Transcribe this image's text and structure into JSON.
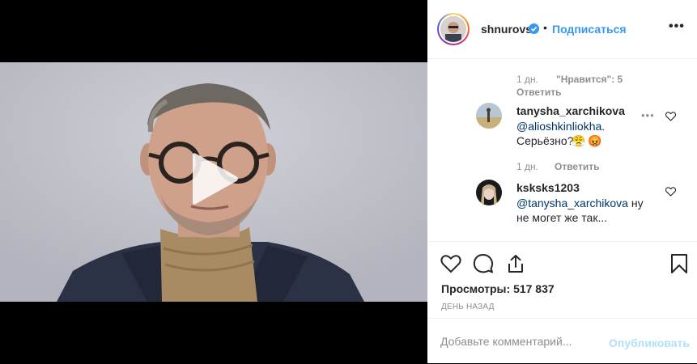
{
  "post": {
    "username": "shnurovs",
    "separator": "•",
    "follow_label": "Подписаться",
    "more_label": "•••"
  },
  "comments": {
    "reply_meta": {
      "time": "1 дн.",
      "likes": "\"Нравится\": 5",
      "reply_label": "Ответить"
    },
    "items": [
      {
        "username": "tanysha_xarchikova",
        "mention": "@alioshkinliokha.",
        "text": "Серьёзно?",
        "emoji": [
          "😤",
          "😡"
        ],
        "time": "1 дн.",
        "reply_label": "Ответить",
        "more_label": "•••"
      },
      {
        "username": "ksksks1203",
        "mention": "@tanysha_xarchikova",
        "text_a": " ну",
        "text_b": "не могет же так..."
      }
    ]
  },
  "stats": {
    "views_label": "Просмотры:",
    "views_value": "517 837",
    "time_ago": "ДЕНЬ НАЗАД"
  },
  "comment_box": {
    "placeholder": "Добавьте комментарий...",
    "publish_label": "Опубликовать"
  },
  "colors": {
    "accent": "#3897f0",
    "publish_disabled": "#b2dffc",
    "text": "#262626",
    "muted": "#8e8e8e",
    "mention": "#003569"
  },
  "icons": [
    "verified-badge-icon",
    "play-icon",
    "heart-icon",
    "comment-icon",
    "share-icon",
    "bookmark-icon",
    "small-heart-icon"
  ]
}
